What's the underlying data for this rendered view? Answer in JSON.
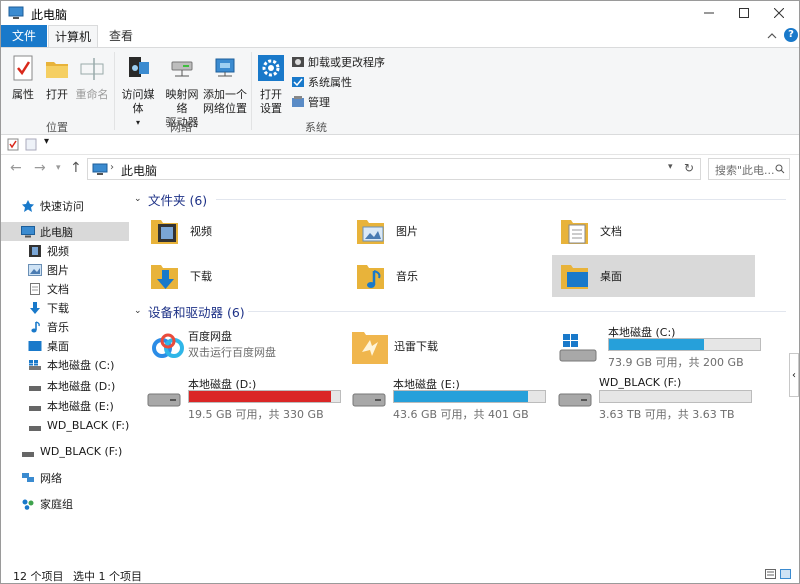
{
  "window": {
    "title": "此电脑"
  },
  "tabs": {
    "file": "文件",
    "computer": "计算机",
    "view": "查看"
  },
  "ribbon": {
    "location": {
      "label": "位置",
      "properties": "属性",
      "open": "打开",
      "rename": "重命名"
    },
    "network": {
      "label": "网络",
      "media_line1": "访问媒体",
      "map_line1": "映射网络",
      "map_line2": "驱动器",
      "add_line1": "添加一个",
      "add_line2": "网络位置"
    },
    "system": {
      "label": "系统",
      "settings_line1": "打开",
      "settings_line2": "设置",
      "uninstall": "卸载或更改程序",
      "sysprops": "系统属性",
      "manage": "管理"
    }
  },
  "address": {
    "crumb": "此电脑",
    "search_placeholder": "搜索\"此电..."
  },
  "nav": {
    "quick_access": "快速访问",
    "this_pc": "此电脑",
    "videos": "视频",
    "pictures": "图片",
    "documents": "文档",
    "downloads": "下载",
    "music": "音乐",
    "desktop": "桌面",
    "disk_c": "本地磁盘 (C:)",
    "disk_d": "本地磁盘 (D:)",
    "disk_e": "本地磁盘 (E:)",
    "wd_f": "WD_BLACK (F:)",
    "wd_f2": "WD_BLACK (F:)",
    "network": "网络",
    "homegroup": "家庭组"
  },
  "folders": {
    "heading": "文件夹 (6)",
    "videos": "视频",
    "pictures": "图片",
    "documents": "文档",
    "downloads": "下载",
    "music": "音乐",
    "desktop": "桌面"
  },
  "devices": {
    "heading": "设备和驱动器 (6)",
    "baidu_name": "百度网盘",
    "baidu_sub": "双击运行百度网盘",
    "xunlei_name": "迅雷下载",
    "c": {
      "name": "本地磁盘 (C:)",
      "sub": "73.9 GB 可用，共 200 GB",
      "used_fraction": 0.63
    },
    "d": {
      "name": "本地磁盘 (D:)",
      "sub": "19.5 GB 可用，共 330 GB",
      "used_fraction": 0.94
    },
    "e": {
      "name": "本地磁盘 (E:)",
      "sub": "43.6 GB 可用，共 401 GB",
      "used_fraction": 0.89
    },
    "f": {
      "name": "WD_BLACK (F:)",
      "sub": "3.63 TB 可用，共 3.63 TB",
      "used_fraction": 0.0
    }
  },
  "status": {
    "count": "12 个项目",
    "selected": "选中 1 个项目"
  },
  "colors": {
    "accent": "#1979ca",
    "bar_normal": "#26a0da",
    "bar_full": "#da2626"
  }
}
